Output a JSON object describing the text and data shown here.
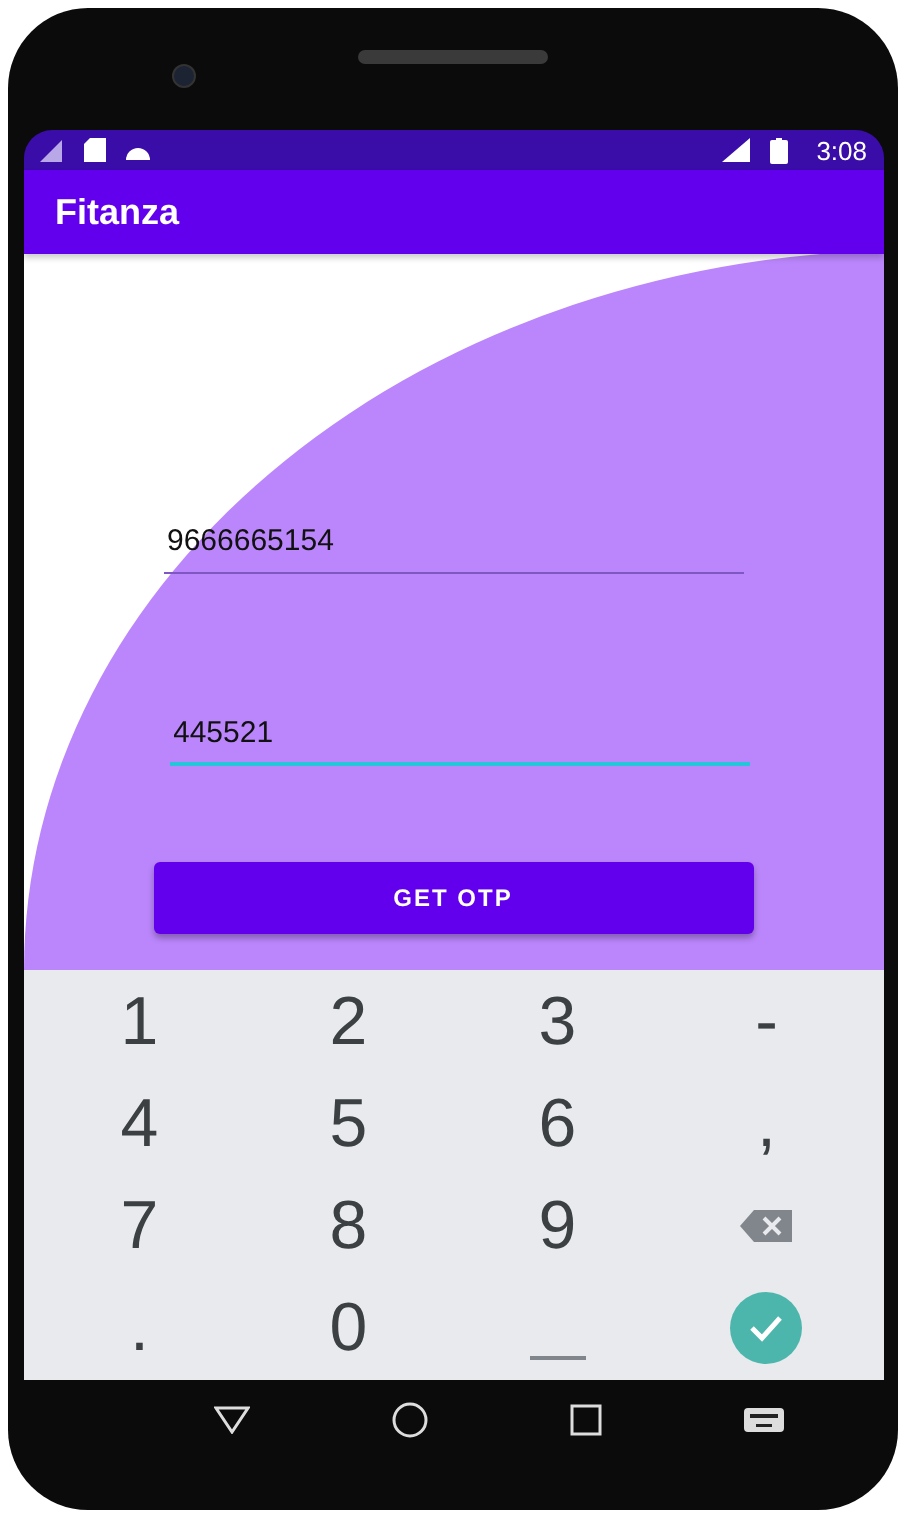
{
  "status_bar": {
    "time": "3:08"
  },
  "app_bar": {
    "title": "Fitanza"
  },
  "fields": [
    {
      "value": "9666665154",
      "focused": false
    },
    {
      "value": "445521",
      "focused": true
    }
  ],
  "button": {
    "label": "GET OTP"
  },
  "keyboard": {
    "keys": [
      {
        "kind": "char",
        "label": "1"
      },
      {
        "kind": "char",
        "label": "2"
      },
      {
        "kind": "char",
        "label": "3"
      },
      {
        "kind": "char",
        "label": "-"
      },
      {
        "kind": "char",
        "label": "4"
      },
      {
        "kind": "char",
        "label": "5"
      },
      {
        "kind": "char",
        "label": "6"
      },
      {
        "kind": "char",
        "label": ","
      },
      {
        "kind": "char",
        "label": "7"
      },
      {
        "kind": "char",
        "label": "8"
      },
      {
        "kind": "char",
        "label": "9"
      },
      {
        "kind": "backspace"
      },
      {
        "kind": "char",
        "label": "."
      },
      {
        "kind": "char",
        "label": "0"
      },
      {
        "kind": "space"
      },
      {
        "kind": "done"
      }
    ]
  }
}
